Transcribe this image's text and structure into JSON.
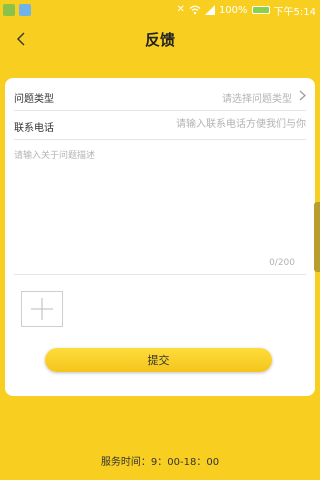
{
  "status_bar": {
    "battery": "100%",
    "time": "下午5:14"
  },
  "header": {
    "title": "反馈"
  },
  "form": {
    "issue_type": {
      "label": "问题类型",
      "placeholder": "请选择问题类型"
    },
    "contact": {
      "label": "联系电话",
      "placeholder": "请输入联系电话方便我们与你"
    },
    "description": {
      "placeholder": "请输入关于问题描述",
      "counter": "0/200"
    },
    "submit_label": "提交"
  },
  "footer": {
    "service_hours": "服务时间：9：00-18：00"
  },
  "icons": {
    "back": "back-arrow-icon",
    "chevron": "chevron-right-icon",
    "add": "plus-icon"
  },
  "colors": {
    "background": "#f8cf21",
    "card": "#ffffff",
    "submit": "#f4c51b"
  }
}
